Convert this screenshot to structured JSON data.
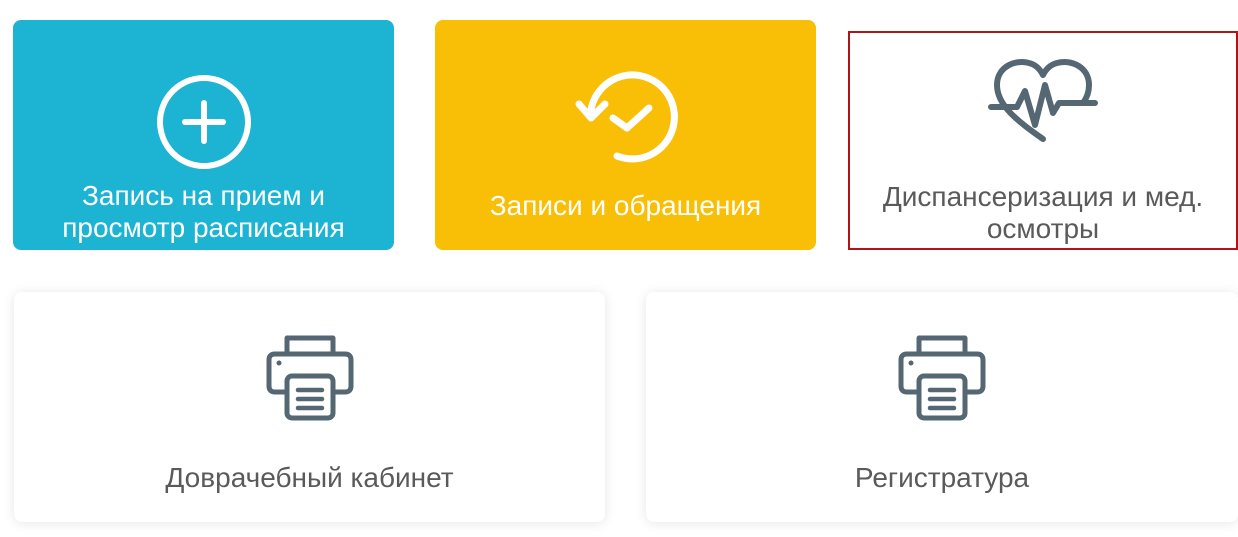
{
  "tiles": [
    {
      "label": "Запись на прием и просмотр расписания",
      "icon": "plus-circle-icon"
    },
    {
      "label": "Записи и обращения",
      "icon": "clock-check-icon"
    },
    {
      "label": "Диспансеризация и мед. осмотры",
      "icon": "heart-pulse-icon",
      "selected": true
    },
    {
      "label": "Доврачебный кабинет",
      "icon": "printer-icon"
    },
    {
      "label": "Регистратура",
      "icon": "printer-icon"
    }
  ],
  "colors": {
    "blue_tile": "#1cb4d2",
    "yellow_tile": "#f9be06",
    "icon_gray": "#546773",
    "label_gray": "#5a5a5a",
    "selected_border": "#b01414"
  }
}
